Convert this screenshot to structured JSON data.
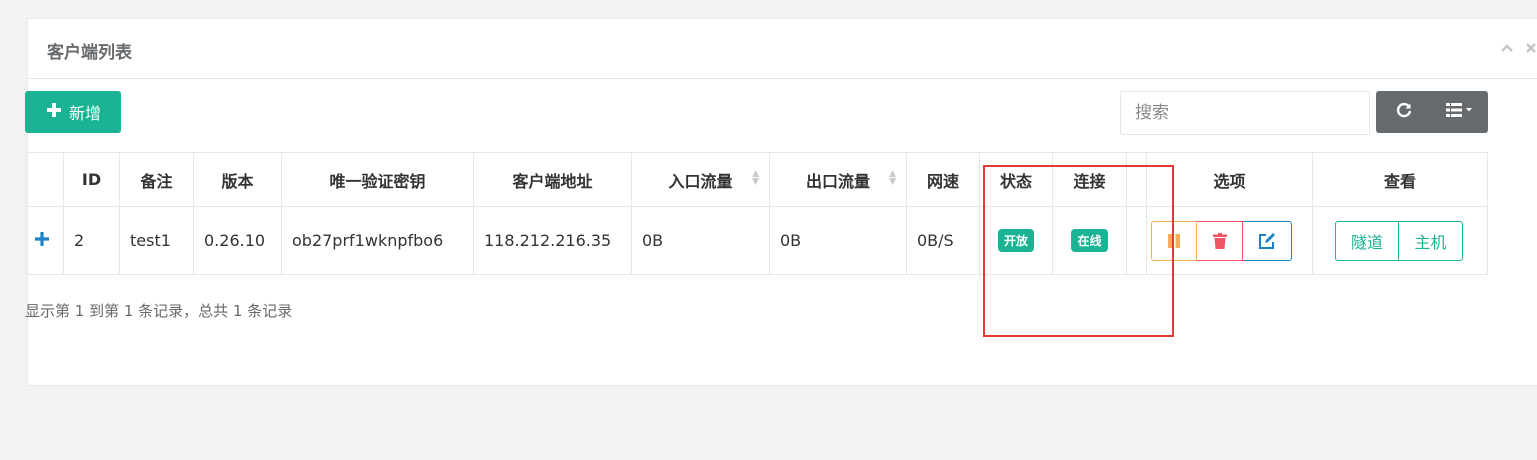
{
  "panel": {
    "title": "客户端列表",
    "collapse_icon": "chevron-up-icon",
    "close_icon": "close-icon"
  },
  "toolbar": {
    "add_label": "新增",
    "search_placeholder": "搜索",
    "refresh_icon": "refresh-icon",
    "columns_icon": "list-icon"
  },
  "table": {
    "headers": [
      "",
      "ID",
      "备注",
      "版本",
      "唯一验证密钥",
      "客户端地址",
      "入口流量",
      "出口流量",
      "网速",
      "状态",
      "连接",
      "",
      "选项",
      "查看"
    ],
    "rows": [
      {
        "expand": "+",
        "id": "2",
        "remark": "test1",
        "version": "0.26.10",
        "key": "ob27prf1wknpfbo6",
        "address": "118.212.216.35",
        "in_flow": "0B",
        "out_flow": "0B",
        "speed": "0B/S",
        "status": "开放",
        "connection": "在线",
        "view_tunnel": "隧道",
        "view_host": "主机"
      }
    ]
  },
  "footer": {
    "summary": "显示第 1 到第 1 条记录，总共 1 条记录"
  },
  "colors": {
    "primary": "#1ab394",
    "warning": "#f8ac59",
    "danger": "#ed5565",
    "info": "#1c84c6",
    "highlight": "#e53935"
  }
}
